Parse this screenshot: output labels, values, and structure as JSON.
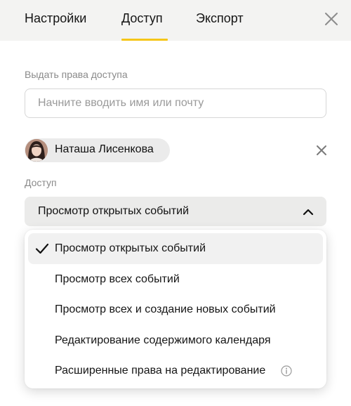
{
  "tabs": [
    {
      "label": "Настройки",
      "active": false
    },
    {
      "label": "Доступ",
      "active": true
    },
    {
      "label": "Экспорт",
      "active": false
    }
  ],
  "icons": {
    "close": "close-icon",
    "remove": "remove-icon",
    "chevron": "chevron-up-icon",
    "check": "check-icon",
    "info": "info-icon"
  },
  "share": {
    "label": "Выдать права доступа",
    "placeholder": "Начните вводить имя или почту",
    "value": ""
  },
  "person": {
    "name": "Наташа Лисенкова"
  },
  "access": {
    "label": "Доступ",
    "selected": "Просмотр открытых событий",
    "options": [
      {
        "label": "Просмотр открытых событий",
        "selected": true
      },
      {
        "label": "Просмотр всех событий",
        "selected": false
      },
      {
        "label": "Просмотр всех и создание новых событий",
        "selected": false
      },
      {
        "label": "Редактирование содержимого календаря",
        "selected": false
      },
      {
        "label": "Расширенные права на редактирование",
        "selected": false,
        "info": true
      }
    ]
  },
  "colors": {
    "accent": "#f5c619",
    "header_bg": "#f3f3f2",
    "select_bg": "#ebebea"
  }
}
